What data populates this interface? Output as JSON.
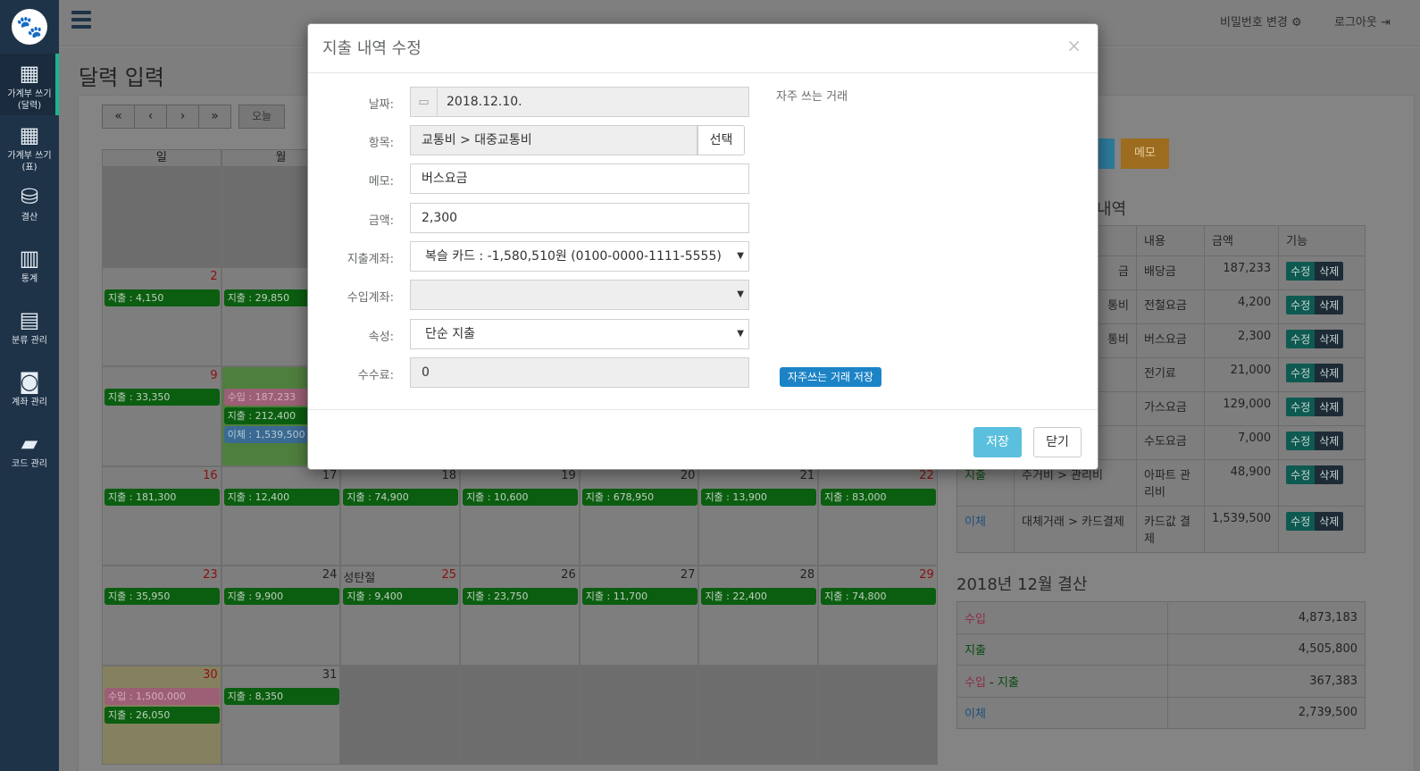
{
  "sidebar": {
    "items": [
      {
        "label": "가계부 쓰기\n(달력)",
        "icon": "calendar-icon"
      },
      {
        "label": "가계부 쓰기\n(표)",
        "icon": "grid-icon"
      },
      {
        "label": "결산",
        "icon": "database-icon"
      },
      {
        "label": "통계",
        "icon": "bar-chart-icon"
      },
      {
        "label": "분류 관리",
        "icon": "building-icon"
      },
      {
        "label": "계좌 관리",
        "icon": "money-icon"
      },
      {
        "label": "코드 관리",
        "icon": "book-icon"
      }
    ]
  },
  "topbar": {
    "change_password": "비밀번호 변경",
    "logout": "로그아웃"
  },
  "page": {
    "title": "달력 입력",
    "today_btn": "오늘"
  },
  "calendar": {
    "weekdays": [
      "일",
      "월"
    ],
    "holiday_25": "성탄절",
    "days": {
      "d2": "2",
      "d9": "9",
      "d16": "16",
      "d17": "17",
      "d18": "18",
      "d19": "19",
      "d20": "20",
      "d21": "21",
      "d22": "22",
      "d23": "23",
      "d24": "24",
      "d25": "25",
      "d26": "26",
      "d27": "27",
      "d28": "28",
      "d29": "29",
      "d30": "30",
      "d31": "31"
    },
    "events": {
      "e2": "지출 : 4,150",
      "e3": "지출 : 29,850",
      "e9": "지출 : 33,350",
      "e10a": "수입 : 187,233",
      "e10b": "지출 : 212,400",
      "e10c": "이체 : 1,539,500",
      "e16": "지출 : 181,300",
      "e17": "지출 : 12,400",
      "e18": "지출 : 74,900",
      "e19": "지출 : 10,600",
      "e20": "지출 : 678,950",
      "e21": "지출 : 13,900",
      "e22": "지출 : 83,000",
      "e23": "지출 : 35,950",
      "e24": "지출 : 9,900",
      "e25": "지출 : 9,400",
      "e26": "지출 : 23,750",
      "e27": "지출 : 11,700",
      "e28": "지출 : 22,400",
      "e29": "지출 : 74,800",
      "e30a": "수입 : 1,500,000",
      "e30b": "지출 : 26,050",
      "e31": "지출 : 8,350"
    }
  },
  "right": {
    "memo_btn": "메모",
    "list_title_tail": "내역",
    "headers": {
      "content": "내용",
      "amount": "금액",
      "func": "기능"
    },
    "rows": [
      {
        "cat": "금",
        "content": "배당금",
        "amount": "187,233"
      },
      {
        "cat": "통비",
        "content": "전철요금",
        "amount": "4,200"
      },
      {
        "cat": "통비",
        "content": "버스요금",
        "amount": "2,300"
      },
      {
        "cat": "",
        "content": "전기료",
        "amount": "21,000"
      },
      {
        "cat": "",
        "content": "가스요금",
        "amount": "129,000"
      },
      {
        "cat": "",
        "content": "수도요금",
        "amount": "7,000"
      },
      {
        "type": "지출",
        "cat": "주거비 > 관리비",
        "content": "아파트 관리비",
        "amount": "48,900"
      },
      {
        "type": "이체",
        "cat": "대체거래 > 카드결제",
        "content": "카드값 결제",
        "amount": "1,539,500"
      }
    ],
    "edit": "수정",
    "delete": "삭제",
    "summary_title": "2018년 12월 결산",
    "summary": [
      {
        "label": "수입",
        "value": "4,873,183"
      },
      {
        "label": "지출",
        "value": "4,505,800"
      },
      {
        "label_a": "수입",
        "label_sep": " - ",
        "label_b": "지출",
        "value": "367,383"
      },
      {
        "label": "이체",
        "value": "2,739,500"
      }
    ]
  },
  "modal": {
    "title": "지출 내역 수정",
    "labels": {
      "date": "날짜:",
      "item": "항목:",
      "memo": "메모:",
      "amount": "금액:",
      "out_account": "지출계좌:",
      "in_account": "수입계좌:",
      "attr": "속성:",
      "fee": "수수료:"
    },
    "values": {
      "date": "2018.12.10.",
      "item": "교통비 > 대중교통비",
      "memo": "버스요금",
      "amount": "2,300",
      "out_account": "복슬 카드 : -1,580,510원 (0100-0000-1111-5555)",
      "in_account": "",
      "attr": "단순 지출",
      "fee": "0"
    },
    "select_btn": "선택",
    "frequent_title": "자주 쓰는 거래",
    "frequent_save": "자주쓰는 거래 저장",
    "save_btn": "저장",
    "close_btn": "닫기"
  }
}
